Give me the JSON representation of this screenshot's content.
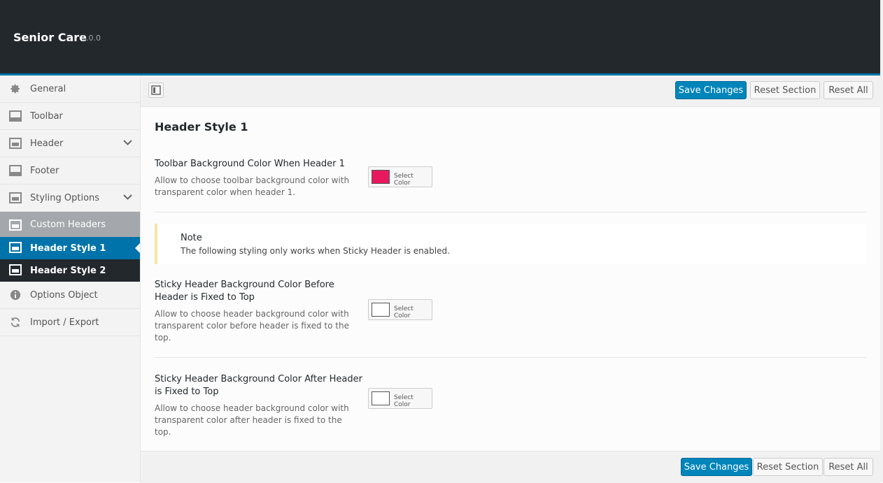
{
  "app": {
    "title": "Senior Care",
    "version": "1.0.0"
  },
  "sidebar": {
    "items": [
      {
        "label": "General",
        "icon": "gear-icon"
      },
      {
        "label": "Toolbar",
        "icon": "panel-icon"
      },
      {
        "label": "Header",
        "icon": "layout-icon"
      },
      {
        "label": "Footer",
        "icon": "panel-icon"
      },
      {
        "label": "Styling Options",
        "icon": "layout-icon"
      },
      {
        "label": "Custom Headers",
        "icon": "layout-icon"
      },
      {
        "label": "Header Style 1",
        "icon": "layout-icon"
      },
      {
        "label": "Header Style 2",
        "icon": "layout-icon"
      },
      {
        "label": "Options Object",
        "icon": "info-icon"
      },
      {
        "label": "Import / Export",
        "icon": "refresh-icon"
      }
    ]
  },
  "toolbar": {
    "save": "Save Changes",
    "reset_section": "Reset Section",
    "reset_all": "Reset All"
  },
  "main": {
    "section_title": "Header Style 1",
    "field1": {
      "title": "Toolbar Background Color When Header 1",
      "desc": "Allow to choose toolbar background color with transparent color when header 1.",
      "button": "Select Color",
      "color": "#e8195f"
    },
    "note": {
      "title": "Note",
      "text": "The following styling only works when Sticky Header is enabled."
    },
    "field2": {
      "title": "Sticky Header Background Color Before Header is Fixed to Top",
      "desc": "Allow to choose header background color with transparent color before header is fixed to the top.",
      "button": "Select Color",
      "color": "#ffffff"
    },
    "field3": {
      "title": "Sticky Header Background Color After Header is Fixed to Top",
      "desc": "Allow to choose header background color with transparent color after header is fixed to the top.",
      "button": "Select Color",
      "color": "#ffffff"
    }
  },
  "footer": {
    "save": "Save Changes",
    "reset_section": "Reset Section",
    "reset_all": "Reset All"
  },
  "colors": {
    "accent": "#0073aa",
    "primary_button": "#0085ba",
    "top_bar": "#23282d"
  }
}
